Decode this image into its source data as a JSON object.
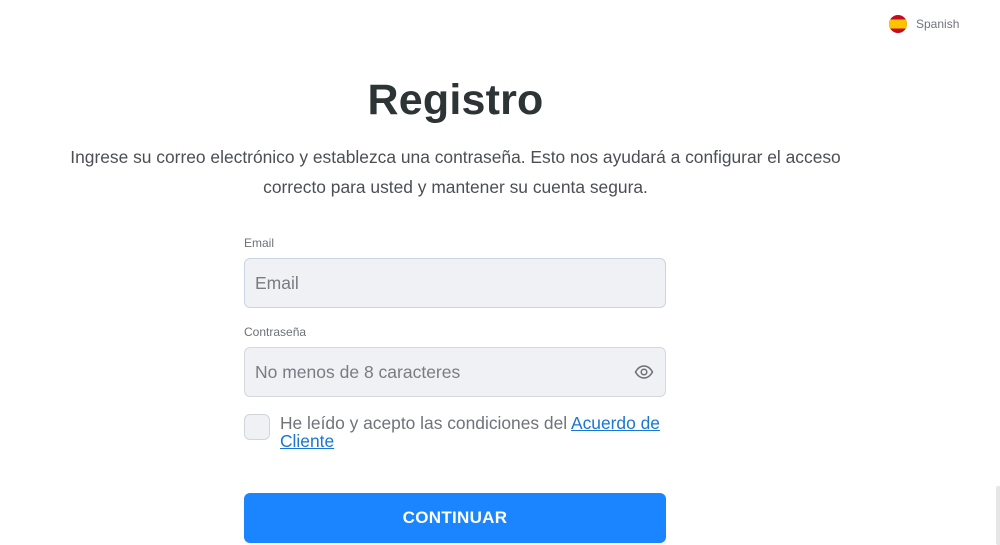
{
  "language": {
    "label": "Spanish",
    "flag_icon": "spain-flag-icon",
    "flag_colors": {
      "red": "#c60b1e",
      "yellow": "#ffc400"
    }
  },
  "header": {
    "title": "Registro",
    "description": "Ingrese su correo electrónico y establezca una contraseña. Esto nos ayudará a configurar el acceso correcto para usted y mantener su cuenta segura."
  },
  "form": {
    "email": {
      "label": "Email",
      "placeholder": "Email",
      "value": ""
    },
    "password": {
      "label": "Contraseña",
      "placeholder": "No menos de 8 caracteres",
      "value": "",
      "toggle_icon": "eye-icon"
    },
    "agreement": {
      "checked": false,
      "text": "He leído y acepto las condiciones del ",
      "link_text": "Acuerdo de Cliente"
    },
    "submit_label": "CONTINUAR"
  },
  "colors": {
    "accent": "#1a85ff",
    "link": "#1976d2",
    "title": "#2d3436",
    "input_bg": "#eff1f4"
  }
}
